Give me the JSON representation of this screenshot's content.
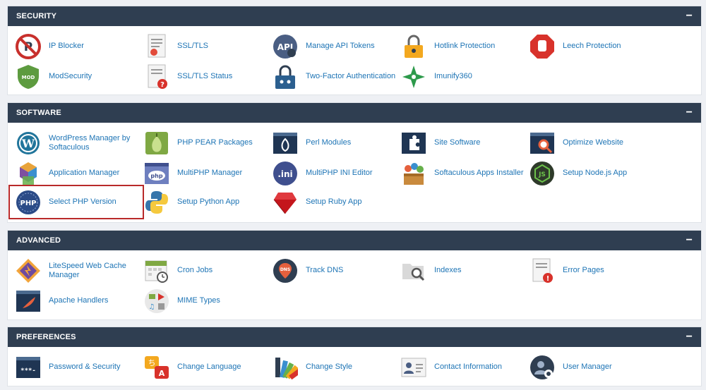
{
  "sections": {
    "security": {
      "title": "SECURITY",
      "toggle": "−",
      "items": [
        "IP Blocker",
        "SSL/TLS",
        "Manage API Tokens",
        "Hotlink Protection",
        "Leech Protection",
        "ModSecurity",
        "SSL/TLS Status",
        "Two-Factor Authentication",
        "Imunify360"
      ]
    },
    "software": {
      "title": "SOFTWARE",
      "toggle": "−",
      "items": [
        "WordPress Manager by Softaculous",
        "PHP PEAR Packages",
        "Perl Modules",
        "Site Software",
        "Optimize Website",
        "Application Manager",
        "MultiPHP Manager",
        "MultiPHP INI Editor",
        "Softaculous Apps Installer",
        "Setup Node.js App",
        "Select PHP Version",
        "Setup Python App",
        "Setup Ruby App"
      ]
    },
    "advanced": {
      "title": "ADVANCED",
      "toggle": "−",
      "items": [
        "LiteSpeed Web Cache Manager",
        "Cron Jobs",
        "Track DNS",
        "Indexes",
        "Error Pages",
        "Apache Handlers",
        "MIME Types"
      ]
    },
    "preferences": {
      "title": "PREFERENCES",
      "toggle": "−",
      "items": [
        "Password & Security",
        "Change Language",
        "Change Style",
        "Contact Information",
        "User Manager"
      ]
    }
  },
  "icon_glyphs": {
    "php": "PHP",
    "api": "API",
    "mod": "MOD",
    "ini": ".ini",
    "multiphp": "php",
    "dns": "DNS",
    "password": "***-",
    "language_a": "A",
    "language_b": "ち"
  },
  "colors": {
    "header_bg": "#2f3e51",
    "link": "#1d74b5",
    "highlight_border": "#b92a2a"
  }
}
